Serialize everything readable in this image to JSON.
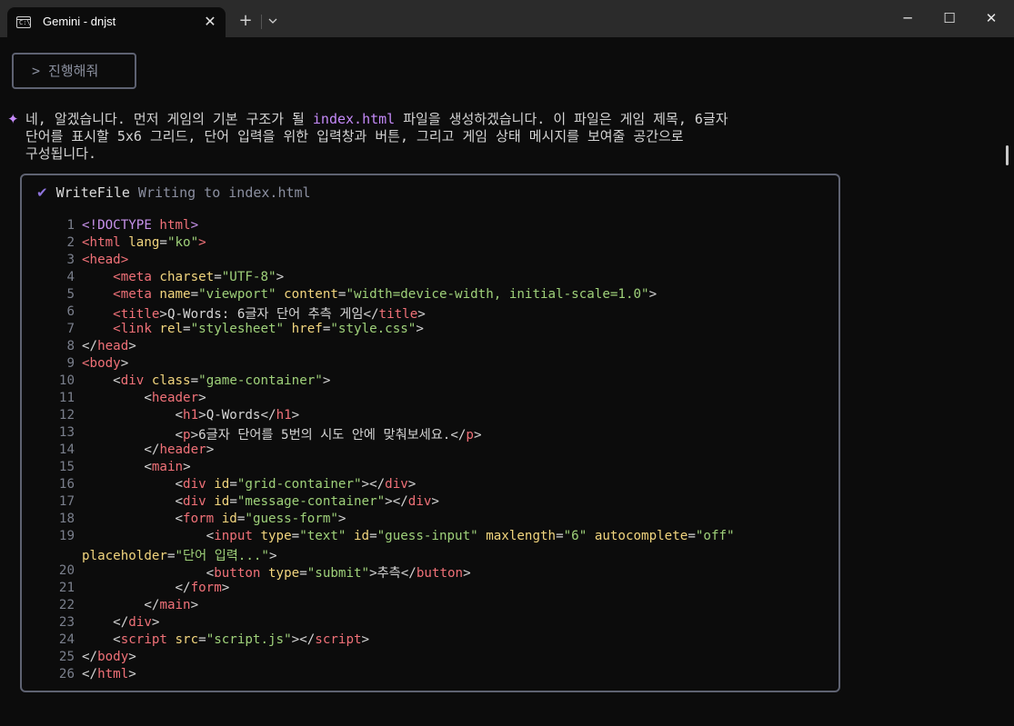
{
  "window": {
    "tab_title": "Gemini - dnjst",
    "tab_icon_glyph": "C:\\",
    "close_glyph": "✕",
    "new_tab_glyph": "+",
    "minimize_glyph": "─",
    "maximize_glyph": "☐",
    "window_close_glyph": "✕"
  },
  "prompt": {
    "label": "> 진행해줘"
  },
  "response": {
    "star": "✦",
    "line1_before": "네, 알겠습니다. 먼저 게임의 기본 구조가 될 ",
    "line1_highlight": "index.html",
    "line1_after": " 파일을 생성하겠습니다. 이 파일은 게임 제목, 6글자",
    "line2": "단어를 표시할 5x6 그리드, 단어 입력을 위한 입력창과 버튼, 그리고 게임 상태 메시지를 보여줄 공간으로",
    "line3": "구성됩니다."
  },
  "tool": {
    "check": "✔",
    "name": "WriteFile",
    "description": "Writing to index.html"
  },
  "code": {
    "lines": [
      {
        "n": "1",
        "tokens": [
          [
            "doc",
            "<!DOCTYPE "
          ],
          [
            "tag",
            "html"
          ],
          [
            "doc",
            ">"
          ]
        ]
      },
      {
        "n": "2",
        "tokens": [
          [
            "tag",
            "<html "
          ],
          [
            "attr",
            "lang"
          ],
          [
            "punc",
            "="
          ],
          [
            "str",
            "\"ko\""
          ],
          [
            "tag",
            ">"
          ]
        ]
      },
      {
        "n": "3",
        "tokens": [
          [
            "tag",
            "<head>"
          ]
        ]
      },
      {
        "n": "4",
        "tokens": [
          [
            "txt",
            "    "
          ],
          [
            "tag",
            "<meta "
          ],
          [
            "attr",
            "charset"
          ],
          [
            "punc",
            "="
          ],
          [
            "str",
            "\"UTF-8\""
          ],
          [
            "punc",
            ">"
          ]
        ]
      },
      {
        "n": "5",
        "tokens": [
          [
            "txt",
            "    "
          ],
          [
            "tag",
            "<meta "
          ],
          [
            "attr",
            "name"
          ],
          [
            "punc",
            "="
          ],
          [
            "str",
            "\"viewport\" "
          ],
          [
            "attr",
            "content"
          ],
          [
            "punc",
            "="
          ],
          [
            "str",
            "\"width=device-width, initial-scale=1.0\""
          ],
          [
            "punc",
            ">"
          ]
        ]
      },
      {
        "n": "6",
        "tokens": [
          [
            "txt",
            "    "
          ],
          [
            "tag",
            "<title"
          ],
          [
            "punc",
            ">"
          ],
          [
            "txt",
            "Q-Words: 6글자 단어 추측 게임"
          ],
          [
            "punc",
            "</"
          ],
          [
            "tag",
            "title"
          ],
          [
            "punc",
            ">"
          ]
        ]
      },
      {
        "n": "7",
        "tokens": [
          [
            "txt",
            "    "
          ],
          [
            "tag",
            "<link "
          ],
          [
            "attr",
            "rel"
          ],
          [
            "punc",
            "="
          ],
          [
            "str",
            "\"stylesheet\" "
          ],
          [
            "attr",
            "href"
          ],
          [
            "punc",
            "="
          ],
          [
            "str",
            "\"style.css\""
          ],
          [
            "punc",
            ">"
          ]
        ]
      },
      {
        "n": "8",
        "tokens": [
          [
            "punc",
            "</"
          ],
          [
            "tag",
            "head"
          ],
          [
            "punc",
            ">"
          ]
        ]
      },
      {
        "n": "9",
        "tokens": [
          [
            "tag",
            "<body"
          ],
          [
            "punc",
            ">"
          ]
        ]
      },
      {
        "n": "10",
        "tokens": [
          [
            "txt",
            "    "
          ],
          [
            "punc",
            "<"
          ],
          [
            "tag",
            "div "
          ],
          [
            "attr",
            "class"
          ],
          [
            "punc",
            "="
          ],
          [
            "str",
            "\"game-container\""
          ],
          [
            "punc",
            ">"
          ]
        ]
      },
      {
        "n": "11",
        "tokens": [
          [
            "txt",
            "        "
          ],
          [
            "punc",
            "<"
          ],
          [
            "tag",
            "header"
          ],
          [
            "punc",
            ">"
          ]
        ]
      },
      {
        "n": "12",
        "tokens": [
          [
            "txt",
            "            "
          ],
          [
            "punc",
            "<"
          ],
          [
            "tag",
            "h1"
          ],
          [
            "punc",
            ">"
          ],
          [
            "txt",
            "Q-Words"
          ],
          [
            "punc",
            "</"
          ],
          [
            "tag",
            "h1"
          ],
          [
            "punc",
            ">"
          ]
        ]
      },
      {
        "n": "13",
        "tokens": [
          [
            "txt",
            "            "
          ],
          [
            "punc",
            "<"
          ],
          [
            "tag",
            "p"
          ],
          [
            "punc",
            ">"
          ],
          [
            "txt",
            "6글자 단어를 5번의 시도 안에 맞춰보세요."
          ],
          [
            "punc",
            "</"
          ],
          [
            "tag",
            "p"
          ],
          [
            "punc",
            ">"
          ]
        ]
      },
      {
        "n": "14",
        "tokens": [
          [
            "txt",
            "        "
          ],
          [
            "punc",
            "</"
          ],
          [
            "tag",
            "header"
          ],
          [
            "punc",
            ">"
          ]
        ]
      },
      {
        "n": "15",
        "tokens": [
          [
            "txt",
            "        "
          ],
          [
            "punc",
            "<"
          ],
          [
            "tag",
            "main"
          ],
          [
            "punc",
            ">"
          ]
        ]
      },
      {
        "n": "16",
        "tokens": [
          [
            "txt",
            "            "
          ],
          [
            "punc",
            "<"
          ],
          [
            "tag",
            "div "
          ],
          [
            "attr",
            "id"
          ],
          [
            "punc",
            "="
          ],
          [
            "str",
            "\"grid-container\""
          ],
          [
            "punc",
            "></"
          ],
          [
            "tag",
            "div"
          ],
          [
            "punc",
            ">"
          ]
        ]
      },
      {
        "n": "17",
        "tokens": [
          [
            "txt",
            "            "
          ],
          [
            "punc",
            "<"
          ],
          [
            "tag",
            "div "
          ],
          [
            "attr",
            "id"
          ],
          [
            "punc",
            "="
          ],
          [
            "str",
            "\"message-container\""
          ],
          [
            "punc",
            "></"
          ],
          [
            "tag",
            "div"
          ],
          [
            "punc",
            ">"
          ]
        ]
      },
      {
        "n": "18",
        "tokens": [
          [
            "txt",
            "            "
          ],
          [
            "punc",
            "<"
          ],
          [
            "tag",
            "form "
          ],
          [
            "attr",
            "id"
          ],
          [
            "punc",
            "="
          ],
          [
            "str",
            "\"guess-form\""
          ],
          [
            "punc",
            ">"
          ]
        ]
      },
      {
        "n": "19",
        "tokens": [
          [
            "txt",
            "                "
          ],
          [
            "punc",
            "<"
          ],
          [
            "tag",
            "input "
          ],
          [
            "attr",
            "type"
          ],
          [
            "punc",
            "="
          ],
          [
            "str",
            "\"text\" "
          ],
          [
            "attr",
            "id"
          ],
          [
            "punc",
            "="
          ],
          [
            "str",
            "\"guess-input\" "
          ],
          [
            "attr",
            "maxlength"
          ],
          [
            "punc",
            "="
          ],
          [
            "str",
            "\"6\" "
          ],
          [
            "attr",
            "autocomplete"
          ],
          [
            "punc",
            "="
          ],
          [
            "str",
            "\"off\""
          ]
        ]
      },
      {
        "n": "",
        "tokens": [
          [
            "attr",
            "placeholder"
          ],
          [
            "punc",
            "="
          ],
          [
            "str",
            "\"단어 입력...\""
          ],
          [
            "punc",
            ">"
          ]
        ]
      },
      {
        "n": "20",
        "tokens": [
          [
            "txt",
            "                "
          ],
          [
            "punc",
            "<"
          ],
          [
            "tag",
            "button "
          ],
          [
            "attr",
            "type"
          ],
          [
            "punc",
            "="
          ],
          [
            "str",
            "\"submit\""
          ],
          [
            "punc",
            ">"
          ],
          [
            "txt",
            "추측"
          ],
          [
            "punc",
            "</"
          ],
          [
            "tag",
            "button"
          ],
          [
            "punc",
            ">"
          ]
        ]
      },
      {
        "n": "21",
        "tokens": [
          [
            "txt",
            "            "
          ],
          [
            "punc",
            "</"
          ],
          [
            "tag",
            "form"
          ],
          [
            "punc",
            ">"
          ]
        ]
      },
      {
        "n": "22",
        "tokens": [
          [
            "txt",
            "        "
          ],
          [
            "punc",
            "</"
          ],
          [
            "tag",
            "main"
          ],
          [
            "punc",
            ">"
          ]
        ]
      },
      {
        "n": "23",
        "tokens": [
          [
            "txt",
            "    "
          ],
          [
            "punc",
            "</"
          ],
          [
            "tag",
            "div"
          ],
          [
            "punc",
            ">"
          ]
        ]
      },
      {
        "n": "24",
        "tokens": [
          [
            "txt",
            "    "
          ],
          [
            "punc",
            "<"
          ],
          [
            "tag",
            "script "
          ],
          [
            "attr",
            "src"
          ],
          [
            "punc",
            "="
          ],
          [
            "str",
            "\"script.js\""
          ],
          [
            "punc",
            "></"
          ],
          [
            "tag",
            "script"
          ],
          [
            "punc",
            ">"
          ]
        ]
      },
      {
        "n": "25",
        "tokens": [
          [
            "punc",
            "</"
          ],
          [
            "tag",
            "body"
          ],
          [
            "punc",
            ">"
          ]
        ]
      },
      {
        "n": "26",
        "tokens": [
          [
            "punc",
            "</"
          ],
          [
            "tag",
            "html"
          ],
          [
            "punc",
            ">"
          ]
        ]
      }
    ]
  }
}
